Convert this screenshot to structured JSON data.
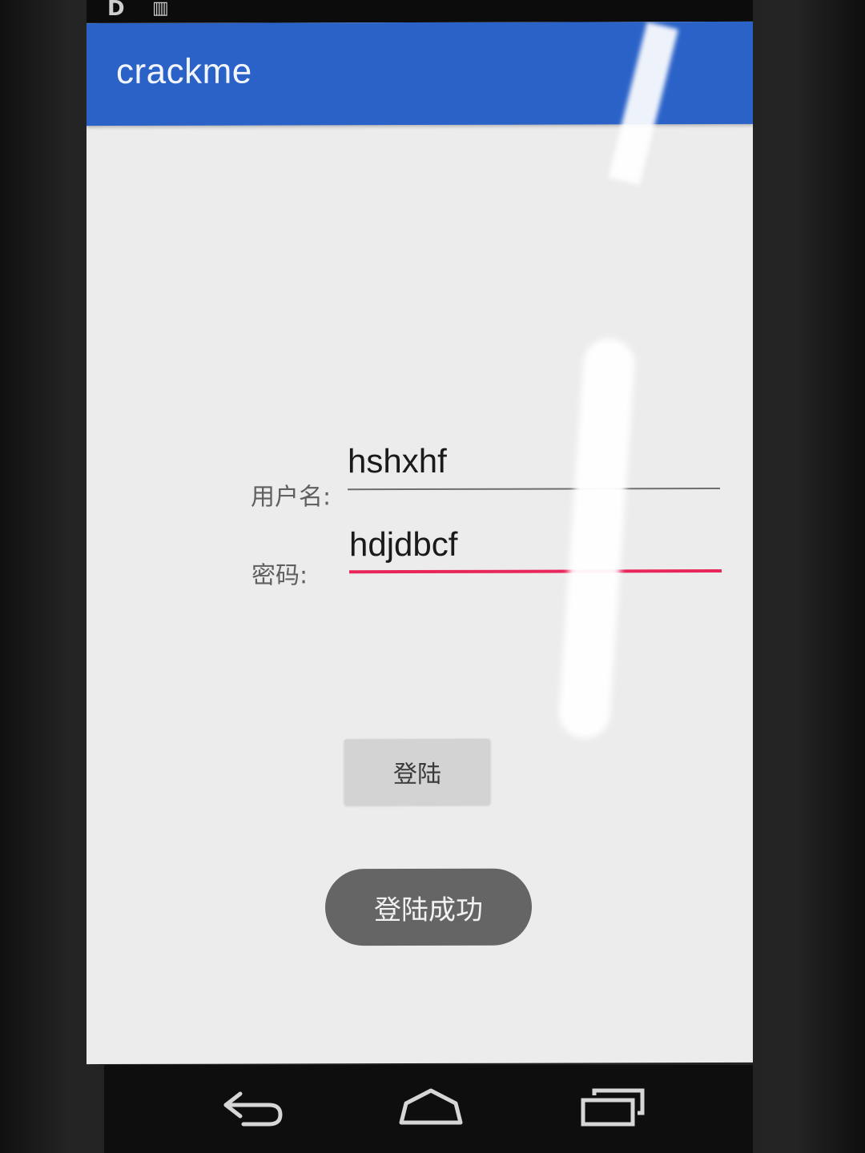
{
  "app_bar": {
    "title": "crackme"
  },
  "form": {
    "username_label": "用户名:",
    "username_value": "hshxhf",
    "password_label": "密码:",
    "password_value": "hdjdbcf"
  },
  "login_button": {
    "label": "登陆"
  },
  "toast": {
    "message": "登陆成功"
  },
  "nav": {
    "back_icon": "back-arrow-icon",
    "home_icon": "home-icon",
    "recents_icon": "recent-apps-icon"
  },
  "colors": {
    "app_bar": "#2a62c8",
    "focused_underline": "#e8265a",
    "screen_bg": "#ececec",
    "toast_bg": "#656565"
  }
}
